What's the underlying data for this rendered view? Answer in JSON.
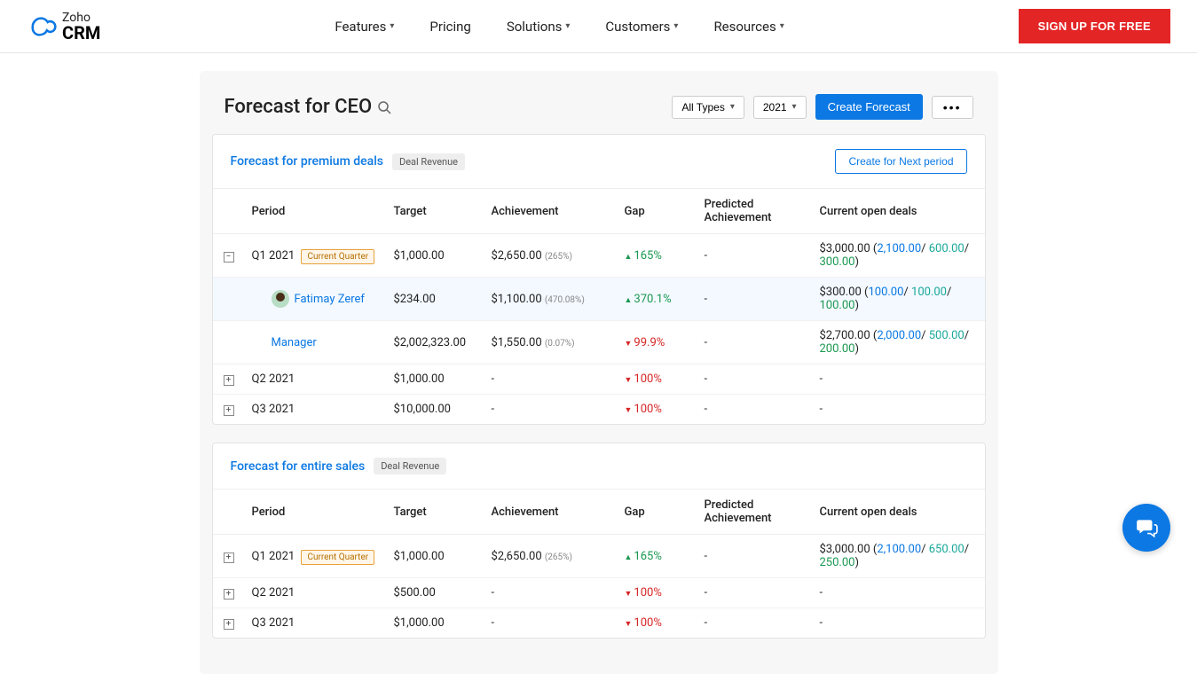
{
  "nav": {
    "brand_top": "Zoho",
    "brand_main": "CRM",
    "links": [
      "Features",
      "Pricing",
      "Solutions",
      "Customers",
      "Resources"
    ],
    "signup": "SIGN UP FOR FREE"
  },
  "header": {
    "title": "Forecast for CEO",
    "filter_type": "All Types",
    "filter_year": "2021",
    "create_btn": "Create Forecast"
  },
  "cards": [
    {
      "title": "Forecast for premium deals",
      "tag": "Deal Revenue",
      "next_btn": "Create for Next period",
      "columns": [
        "Period",
        "Target",
        "Achievement",
        "Gap",
        "Predicted Achievement",
        "Current open deals"
      ],
      "rows": [
        {
          "expand": "minus",
          "period": "Q1 2021",
          "current": "Current Quarter",
          "target": "$1,000.00",
          "achievement": "$2,650.00",
          "ach_pct": "(265%)",
          "gap_dir": "up",
          "gap": "165%",
          "predicted": "-",
          "open_total": "$3,000.00",
          "open_parts": [
            "2,100.00",
            "600.00",
            "300.00"
          ]
        },
        {
          "child": true,
          "avatar": true,
          "person": "Fatimay Zeref",
          "target": "$234.00",
          "achievement": "$1,100.00",
          "ach_pct": "(470.08%)",
          "gap_dir": "up",
          "gap": "370.1%",
          "predicted": "-",
          "open_total": "$300.00",
          "open_parts": [
            "100.00",
            "100.00",
            "100.00"
          ]
        },
        {
          "child2": true,
          "person": "Manager",
          "target": "$2,002,323.00",
          "achievement": "$1,550.00",
          "ach_pct": "(0.07%)",
          "gap_dir": "down",
          "gap": "99.9%",
          "predicted": "-",
          "open_total": "$2,700.00",
          "open_parts": [
            "2,000.00",
            "500.00",
            "200.00"
          ]
        },
        {
          "expand": "plus",
          "period": "Q2 2021",
          "target": "$1,000.00",
          "achievement": "-",
          "gap_dir": "down",
          "gap": "100%",
          "predicted": "-",
          "open_total": "-"
        },
        {
          "expand": "plus",
          "period": "Q3 2021",
          "target": "$10,000.00",
          "achievement": "-",
          "gap_dir": "down",
          "gap": "100%",
          "predicted": "-",
          "open_total": "-"
        }
      ]
    },
    {
      "title": "Forecast for entire sales",
      "tag": "Deal Revenue",
      "columns": [
        "Period",
        "Target",
        "Achievement",
        "Gap",
        "Predicted Achievement",
        "Current open deals"
      ],
      "rows": [
        {
          "expand": "plus",
          "period": "Q1 2021",
          "current": "Current Quarter",
          "target": "$1,000.00",
          "achievement": "$2,650.00",
          "ach_pct": "(265%)",
          "gap_dir": "up",
          "gap": "165%",
          "predicted": "-",
          "open_total": "$3,000.00",
          "open_parts": [
            "2,100.00",
            "650.00",
            "250.00"
          ]
        },
        {
          "expand": "plus",
          "period": "Q2 2021",
          "target": "$500.00",
          "achievement": "-",
          "gap_dir": "down",
          "gap": "100%",
          "predicted": "-",
          "open_total": "-"
        },
        {
          "expand": "plus",
          "period": "Q3 2021",
          "target": "$1,000.00",
          "achievement": "-",
          "gap_dir": "down",
          "gap": "100%",
          "predicted": "-",
          "open_total": "-"
        }
      ]
    }
  ]
}
